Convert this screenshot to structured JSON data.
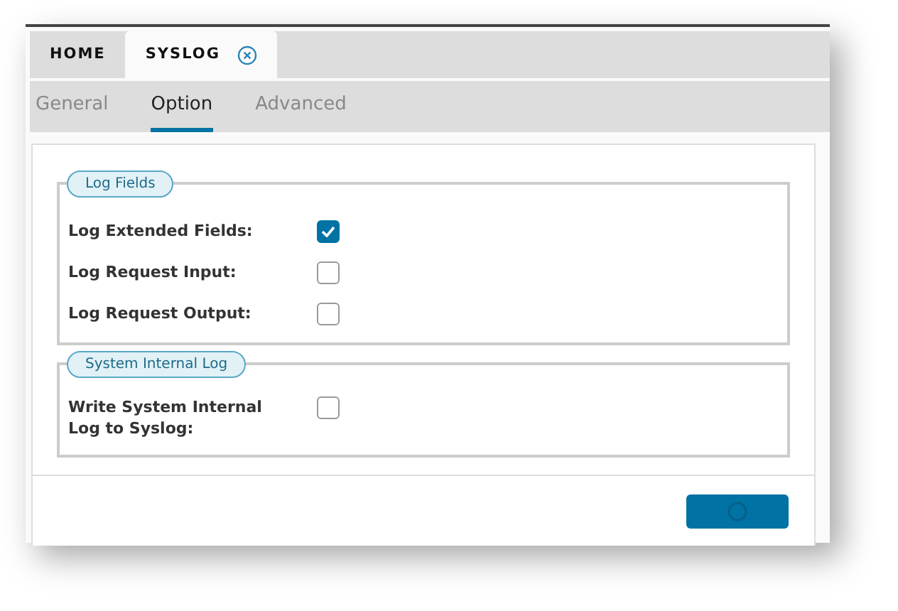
{
  "tabs": [
    {
      "label": "HOME",
      "selected": false,
      "closable": false
    },
    {
      "label": "SYSLOG",
      "selected": true,
      "closable": true
    }
  ],
  "subtabs": [
    {
      "label": "General",
      "selected": false
    },
    {
      "label": "Option",
      "selected": true
    },
    {
      "label": "Advanced",
      "selected": false
    }
  ],
  "groups": [
    {
      "legend": "Log Fields",
      "fields": [
        {
          "label": "Log Extended Fields:",
          "checked": true
        },
        {
          "label": "Log Request Input:",
          "checked": false
        },
        {
          "label": "Log Request Output:",
          "checked": false
        }
      ]
    },
    {
      "legend": "System Internal Log",
      "fields": [
        {
          "label": "Write System Internal Log to Syslog:",
          "checked": false
        }
      ]
    }
  ],
  "footer_button": {
    "busy": true
  }
}
